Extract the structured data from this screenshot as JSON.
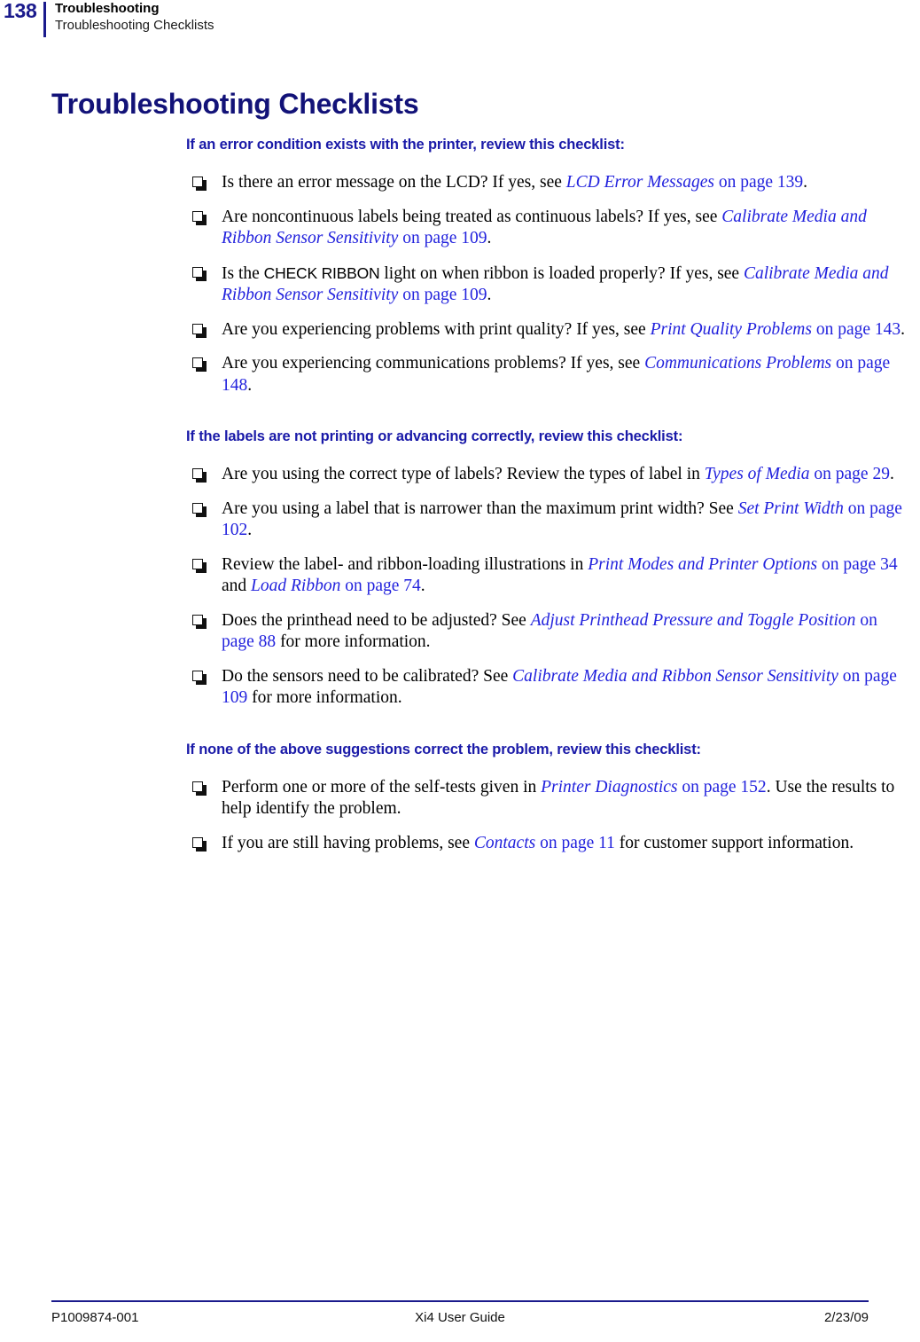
{
  "header": {
    "page_number": "138",
    "chapter": "Troubleshooting",
    "section": "Troubleshooting Checklists"
  },
  "title": "Troubleshooting Checklists",
  "sections": [
    {
      "heading": "If an error condition exists with the printer, review this checklist:",
      "items": [
        {
          "parts": [
            {
              "type": "text",
              "value": "Is there an error message on the LCD? If yes, see "
            },
            {
              "type": "xref",
              "value": "LCD Error Messages"
            },
            {
              "type": "xref-plain",
              "value": " on page 139"
            },
            {
              "type": "text",
              "value": "."
            }
          ]
        },
        {
          "parts": [
            {
              "type": "text",
              "value": "Are noncontinuous labels being treated as continuous labels? If yes, see "
            },
            {
              "type": "xref",
              "value": "Calibrate Media and Ribbon Sensor Sensitivity"
            },
            {
              "type": "xref-plain",
              "value": " on page 109"
            },
            {
              "type": "text",
              "value": "."
            }
          ]
        },
        {
          "parts": [
            {
              "type": "text",
              "value": "Is the "
            },
            {
              "type": "ui",
              "value": "CHECK RIBBON"
            },
            {
              "type": "text",
              "value": " light on when ribbon is loaded properly? If yes, see "
            },
            {
              "type": "xref",
              "value": "Calibrate Media and Ribbon Sensor Sensitivity"
            },
            {
              "type": "xref-plain",
              "value": " on page 109"
            },
            {
              "type": "text",
              "value": "."
            }
          ]
        },
        {
          "parts": [
            {
              "type": "text",
              "value": "Are you experiencing problems with print quality? If yes, see "
            },
            {
              "type": "xref",
              "value": "Print Quality Problems"
            },
            {
              "type": "xref-plain",
              "value": " on page 143"
            },
            {
              "type": "text",
              "value": "."
            }
          ]
        },
        {
          "parts": [
            {
              "type": "text",
              "value": "Are you experiencing communications problems? If yes, see "
            },
            {
              "type": "xref",
              "value": "Communications Problems"
            },
            {
              "type": "xref-plain",
              "value": " on page 148"
            },
            {
              "type": "text",
              "value": "."
            }
          ]
        }
      ]
    },
    {
      "heading": "If the labels are not printing or advancing correctly, review this checklist:",
      "items": [
        {
          "parts": [
            {
              "type": "text",
              "value": "Are you using the correct type of labels? Review the types of label in "
            },
            {
              "type": "xref",
              "value": "Types of Media"
            },
            {
              "type": "xref-plain",
              "value": " on page 29"
            },
            {
              "type": "text",
              "value": "."
            }
          ]
        },
        {
          "parts": [
            {
              "type": "text",
              "value": "Are you using a label that is narrower than the maximum print width? See "
            },
            {
              "type": "xref",
              "value": "Set Print Width"
            },
            {
              "type": "xref-plain",
              "value": " on page 102"
            },
            {
              "type": "text",
              "value": "."
            }
          ]
        },
        {
          "parts": [
            {
              "type": "text",
              "value": "Review the label- and ribbon-loading illustrations in "
            },
            {
              "type": "xref",
              "value": "Print Modes and Printer Options"
            },
            {
              "type": "xref-plain",
              "value": " on page 34"
            },
            {
              "type": "text",
              "value": " and "
            },
            {
              "type": "xref",
              "value": "Load Ribbon"
            },
            {
              "type": "xref-plain",
              "value": " on page 74"
            },
            {
              "type": "text",
              "value": "."
            }
          ]
        },
        {
          "parts": [
            {
              "type": "text",
              "value": "Does the printhead need to be adjusted? See "
            },
            {
              "type": "xref",
              "value": "Adjust Printhead Pressure and Toggle Position"
            },
            {
              "type": "xref-plain",
              "value": " on page 88"
            },
            {
              "type": "text",
              "value": " for more information."
            }
          ]
        },
        {
          "parts": [
            {
              "type": "text",
              "value": "Do the sensors need to be calibrated? See "
            },
            {
              "type": "xref",
              "value": "Calibrate Media and Ribbon Sensor Sensitivity"
            },
            {
              "type": "xref-plain",
              "value": " on page 109"
            },
            {
              "type": "text",
              "value": " for more information."
            }
          ]
        }
      ]
    },
    {
      "heading": "If none of the above suggestions correct the problem, review this checklist:",
      "items": [
        {
          "parts": [
            {
              "type": "text",
              "value": "Perform one or more of the self-tests given in "
            },
            {
              "type": "xref",
              "value": "Printer Diagnostics"
            },
            {
              "type": "xref-plain",
              "value": " on page 152"
            },
            {
              "type": "text",
              "value": ". Use the results to help identify the problem."
            }
          ]
        },
        {
          "parts": [
            {
              "type": "text",
              "value": "If you are still having problems, see "
            },
            {
              "type": "xref",
              "value": "Contacts"
            },
            {
              "type": "xref-plain",
              "value": " on page 11"
            },
            {
              "type": "text",
              "value": " for customer support information."
            }
          ]
        }
      ]
    }
  ],
  "footer": {
    "part_number": "P1009874-001",
    "guide_title": "Xi4 User Guide",
    "date": "2/23/09"
  },
  "colors": {
    "navy": "#1a1a8c",
    "title_navy": "#121278",
    "heading_blue": "#1a1aa8",
    "link_blue": "#2222dd",
    "body_black": "#000000"
  }
}
